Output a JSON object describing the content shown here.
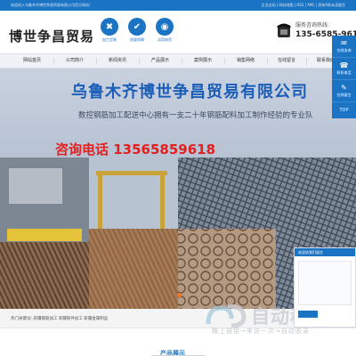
{
  "topbar": {
    "welcome": "欢迎进入乌鲁木齐博世争昌贸易有限公司官方网站!",
    "links": "企业全站 | 网站地图 | RSS | XML | 您有0条未读留言"
  },
  "header": {
    "logo_text": "博世争昌贸易",
    "features": [
      {
        "label": "加工定制",
        "icon": "tools-icon"
      },
      {
        "label": "质量保障",
        "icon": "shield-icon"
      },
      {
        "label": "试用体验",
        "icon": "experience-icon"
      }
    ],
    "hotline_label": "服务咨询热线:",
    "hotline_number": "135-6585-9618"
  },
  "nav": {
    "items": [
      "网站首页",
      "公司简介",
      "新闻资讯",
      "产品展示",
      "案例展示",
      "销售网络",
      "在线留言",
      "联系我们"
    ]
  },
  "banner": {
    "title": "乌鲁木齐博世争昌贸易有限公司",
    "desc": "数控钢筋加工配送中心拥有一支二十年钢筋配料加工制作经验的专业队",
    "phone": "咨询电话 13565859618"
  },
  "hotwords": {
    "line": "热门关键词: 新疆钢筋加工  新疆铁件加工  新疆金属制品"
  },
  "section": {
    "title": "产品展示"
  },
  "floater": {
    "items": [
      {
        "label": "在线咨询",
        "icon": "chat-icon"
      },
      {
        "label": "联系电话",
        "icon": "phone-icon"
      },
      {
        "label": "在线留言",
        "icon": "edit-icon"
      }
    ],
    "top_label": "TOP"
  },
  "msgbox": {
    "header": "欢迎给我们留言"
  },
  "watermark": {
    "text": "自动秘收录",
    "sub": "趣上链接→来访一次→自动收录"
  },
  "colors": {
    "brand": "#1b73c4",
    "phone_red": "#e31f1f",
    "dot_orange": "#f47a20"
  }
}
